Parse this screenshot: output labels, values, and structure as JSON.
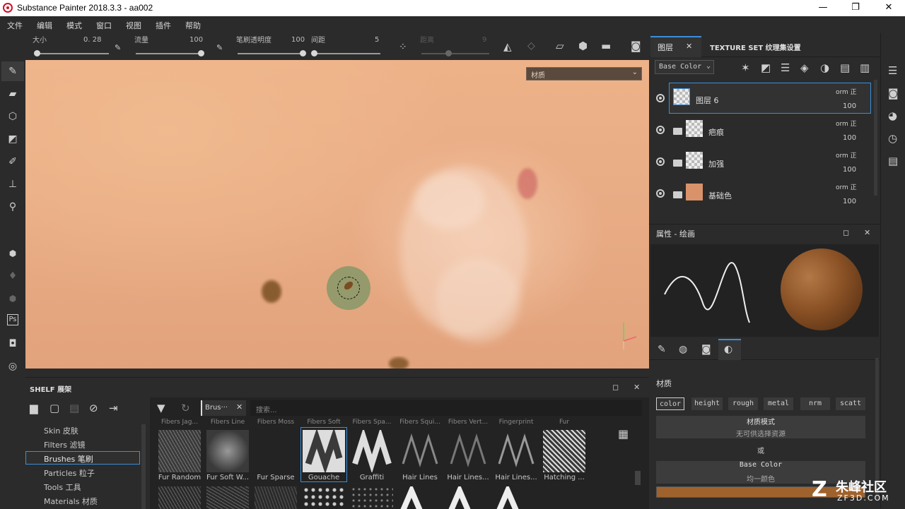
{
  "window": {
    "title": "Substance Painter 2018.3.3 - aa002",
    "min": "—",
    "max": "❐",
    "close": "✕"
  },
  "menu": [
    "文件",
    "编辑",
    "模式",
    "窗口",
    "视图",
    "插件",
    "帮助"
  ],
  "toolbar": {
    "size_label": "大小",
    "size_value": "0. 28",
    "flow_label": "流量",
    "flow_value": "100",
    "opacity_label": "笔刷透明度",
    "opacity_value": "100",
    "spacing_label": "间距",
    "spacing_value": "5",
    "distance_label": "距离",
    "distance_value": "9"
  },
  "viewport": {
    "material_dropdown": "材质"
  },
  "layers_panel": {
    "tab_layers": "图层",
    "tab_texture_set": "TEXTURE SET 纹理集设置",
    "channel_dropdown": "Base Color",
    "layers": [
      {
        "name": "图层 6",
        "blend": "orm 正",
        "opacity": "100"
      },
      {
        "name": "疤痕",
        "blend": "orm 正",
        "opacity": "100"
      },
      {
        "name": "加强",
        "blend": "orm 正",
        "opacity": "100"
      },
      {
        "name": "基础色",
        "blend": "orm 正",
        "opacity": "100"
      }
    ]
  },
  "properties": {
    "title": "属性 - 绘画",
    "material_header": "材质",
    "channels": [
      "color",
      "height",
      "rough",
      "metal",
      "nrm",
      "scatt"
    ],
    "material_mode_title": "材质模式",
    "material_mode_sub": "无可供选择资源",
    "or": "或",
    "base_color_title": "Base Color",
    "base_color_sub": "均一颜色",
    "base_color_hex": "#a0622c"
  },
  "shelf": {
    "title": "SHELF 展架",
    "search_placeholder": "搜索...",
    "filter_tag": "Brus···",
    "categories": [
      "Skin 皮肤",
      "Filters 滤镜",
      "Brushes 笔刷",
      "Particles 粒子",
      "Tools 工具",
      "Materials 材质"
    ],
    "brushes": [
      "Fur Random",
      "Fur Soft W...",
      "Fur Sparse",
      "Gouache",
      "Graffiti",
      "Hair Lines",
      "Hair Lines...",
      "Hair Lines...",
      "Hatching ..."
    ],
    "partial_labels": [
      "Fibers Jag...",
      "Fibers Line",
      "Fibers Moss",
      "Fibers Soft",
      "Fibers Spa...",
      "Fibers Squi...",
      "Fibers Vert...",
      "Fingerprint",
      "Fur"
    ]
  },
  "watermark": {
    "brand": "朱峰社区",
    "url": "ZF3D.COM"
  }
}
